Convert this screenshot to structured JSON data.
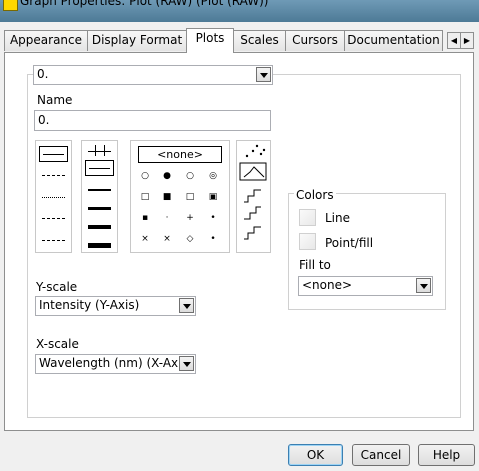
{
  "window": {
    "title": "Graph Properties: Plot (RAW) (Plot (RAW))"
  },
  "tabs": [
    {
      "label": "Appearance"
    },
    {
      "label": "Display Format"
    },
    {
      "label": "Plots"
    },
    {
      "label": "Scales"
    },
    {
      "label": "Cursors"
    },
    {
      "label": "Documentation"
    }
  ],
  "active_tab": "Plots",
  "plot_selector": {
    "value": "0."
  },
  "name": {
    "label": "Name",
    "value": "0."
  },
  "point_style_none": "<none>",
  "colors": {
    "heading": "Colors",
    "line_label": "Line",
    "point_fill_label": "Point/fill",
    "fill_to_label": "Fill to",
    "fill_to_value": "<none>"
  },
  "y_scale": {
    "label": "Y-scale",
    "value": "Intensity (Y-Axis)"
  },
  "x_scale": {
    "label": "X-scale",
    "value": "Wavelength (nm) (X-Axis)"
  },
  "buttons": {
    "ok": "OK",
    "cancel": "Cancel",
    "help": "Help"
  }
}
